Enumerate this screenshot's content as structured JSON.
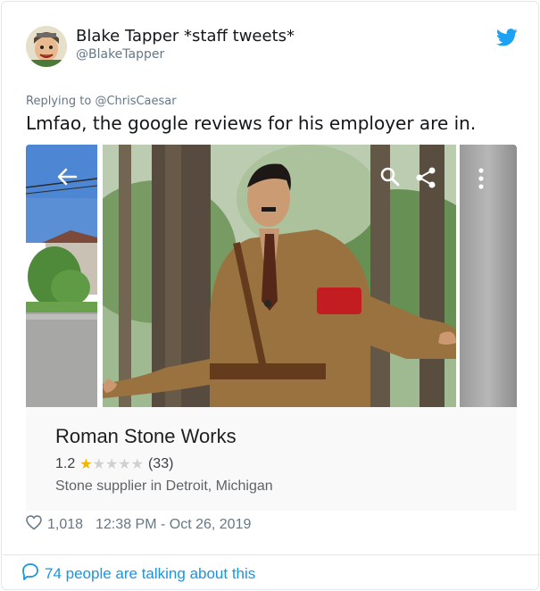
{
  "tweet": {
    "display_name": "Blake Tapper *staff tweets*",
    "handle": "@BlakeTapper",
    "replying_prefix": "Replying to",
    "replying_to": "@ChrisCaesar",
    "text": "Lmfao, the google reviews for his employer are in.",
    "like_count": "1,018",
    "timestamp": "12:38 PM - Oct 26, 2019",
    "talking_text": "74 people are talking about this"
  },
  "place_card": {
    "business_name": "Roman Stone Works",
    "rating": "1.2",
    "rating_fraction": 0.24,
    "review_count": "(33)",
    "category": "Stone supplier in Detroit, Michigan",
    "icons": [
      "back-arrow-icon",
      "search-icon",
      "share-icon",
      "more-vert-icon"
    ]
  },
  "colors": {
    "twitter_blue": "#1da1f2",
    "link_blue": "#1b95e0",
    "star_gold": "#f4b400",
    "muted_gray": "#657786"
  }
}
